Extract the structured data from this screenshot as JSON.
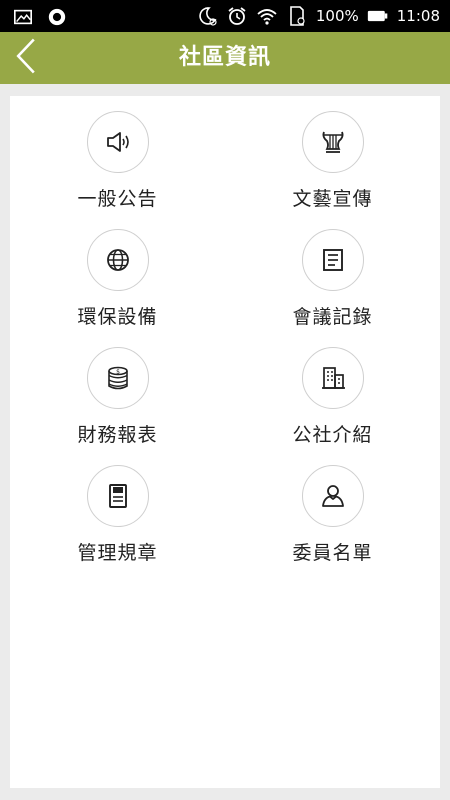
{
  "status_bar": {
    "battery": "100%",
    "time": "11:08",
    "icons": [
      "gallery-icon",
      "record-icon",
      "moon-alarm-icon",
      "alarm-icon",
      "wifi-icon",
      "sd-card-icon",
      "battery-icon"
    ]
  },
  "header": {
    "title": "社區資訊",
    "back_icon": "chevron-left-icon",
    "background": "#97a846"
  },
  "menu": {
    "items": [
      {
        "label": "一般公告",
        "icon": "megaphone-icon"
      },
      {
        "label": "文藝宣傳",
        "icon": "lyre-icon"
      },
      {
        "label": "環保設備",
        "icon": "globe-icon"
      },
      {
        "label": "會議記錄",
        "icon": "document-icon"
      },
      {
        "label": "財務報表",
        "icon": "coins-icon"
      },
      {
        "label": "公社介紹",
        "icon": "building-icon"
      },
      {
        "label": "管理規章",
        "icon": "rules-icon"
      },
      {
        "label": "委員名單",
        "icon": "person-icon"
      }
    ]
  }
}
